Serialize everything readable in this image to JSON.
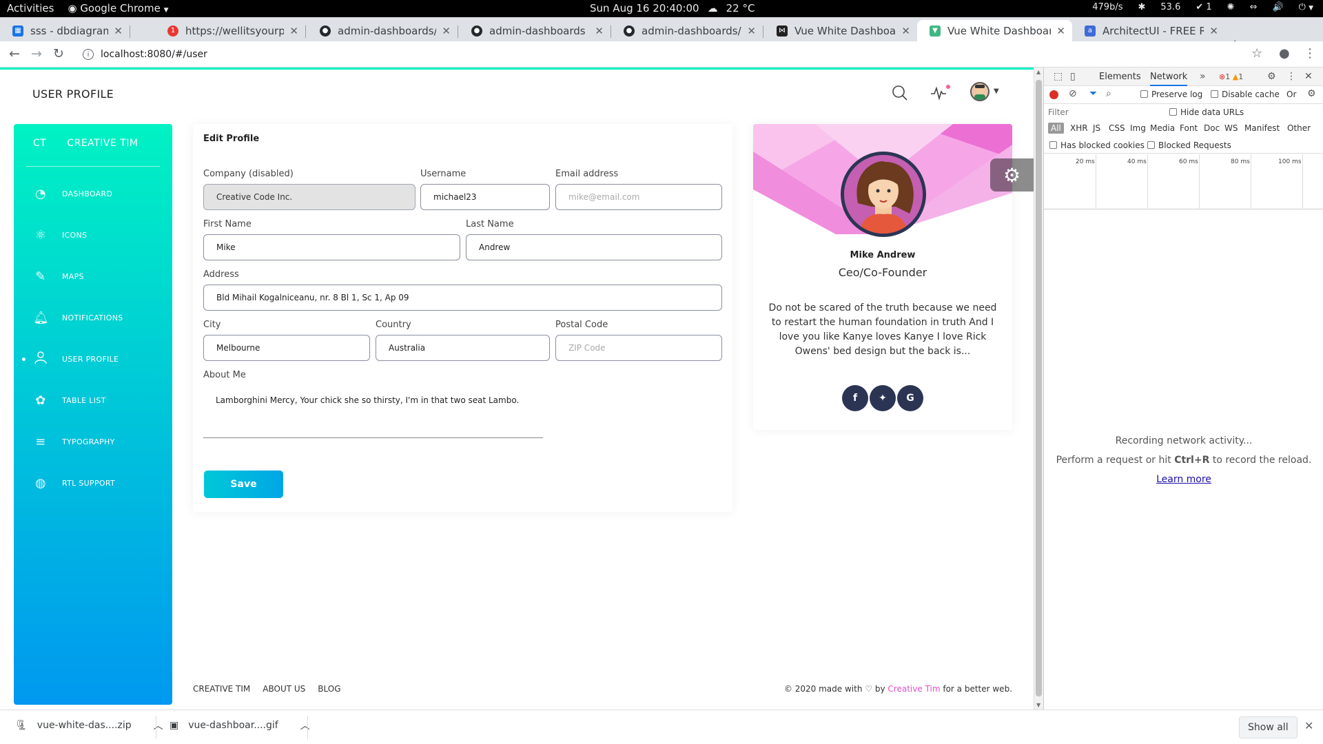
{
  "system_bar": {
    "activities": "Activities",
    "app_name": "Google Chrome",
    "clock": "Sun Aug 16  20:40:00",
    "weather": "22 °C",
    "net_speed": "479b/s",
    "value2": "53.6",
    "tray_indicator": "1"
  },
  "tabs": [
    {
      "label": "sss - dbdiagram.io"
    },
    {
      "label": "https://wellitsyourplac"
    },
    {
      "label": "admin-dashboards/bo"
    },
    {
      "label": "admin-dashboards (Ac"
    },
    {
      "label": "admin-dashboards/vu"
    },
    {
      "label": "Vue White Dashboard"
    },
    {
      "label": "Vue White Dashboard b"
    },
    {
      "label": "ArchitectUI - FREE Rea"
    }
  ],
  "tab_badge": "1",
  "url": "localhost:8080/#/user",
  "page": {
    "header_title": "USER PROFILE",
    "brand": {
      "short": "CT",
      "name": "CREATIVE TIM"
    },
    "sidebar": [
      {
        "label": "DASHBOARD"
      },
      {
        "label": "ICONS"
      },
      {
        "label": "MAPS"
      },
      {
        "label": "NOTIFICATIONS"
      },
      {
        "label": "USER PROFILE"
      },
      {
        "label": "TABLE LIST"
      },
      {
        "label": "TYPOGRAPHY"
      },
      {
        "label": "RTL SUPPORT"
      }
    ],
    "edit_profile": {
      "title": "Edit Profile",
      "company_label": "Company (disabled)",
      "company_value": "Creative Code Inc.",
      "username_label": "Username",
      "username_value": "michael23",
      "email_label": "Email address",
      "email_placeholder": "mike@email.com",
      "first_name_label": "First Name",
      "first_name_value": "Mike",
      "last_name_label": "Last Name",
      "last_name_value": "Andrew",
      "address_label": "Address",
      "address_value": "Bld Mihail Kogalniceanu, nr. 8 Bl 1, Sc 1, Ap 09",
      "city_label": "City",
      "city_value": "Melbourne",
      "country_label": "Country",
      "country_value": "Australia",
      "postal_label": "Postal Code",
      "postal_placeholder": "ZIP Code",
      "about_label": "About Me",
      "about_value": "Lamborghini Mercy, Your chick she so thirsty, I'm in that two seat Lambo.",
      "save_label": "Save"
    },
    "profile_card": {
      "name": "Mike Andrew",
      "role": "Ceo/Co-Founder",
      "bio": "Do not be scared of the truth because we need to restart the human foundation in truth And I love you like Kanye loves Kanye I love Rick Owens' bed design but the back is..."
    },
    "footer": {
      "links": [
        "CREATIVE TIM",
        "ABOUT US",
        "BLOG"
      ],
      "copy_prefix": "© 2020 made with",
      "copy_by": "by",
      "copy_link": "Creative Tim",
      "copy_suffix": "for a better web."
    },
    "colors": {
      "accent": "#00f2c3",
      "accent2": "#0098f0",
      "primary": "#e14eca"
    }
  },
  "devtools": {
    "tab_elements": "Elements",
    "tab_network": "Network",
    "errors": "1",
    "warnings": "1",
    "preserve_log": "Preserve log",
    "disable_cache": "Disable cache",
    "throttle": "Or",
    "filter_placeholder": "Filter",
    "hide_data_urls": "Hide data URLs",
    "types": [
      "All",
      "XHR",
      "JS",
      "CSS",
      "Img",
      "Media",
      "Font",
      "Doc",
      "WS",
      "Manifest",
      "Other"
    ],
    "has_blocked_cookies": "Has blocked cookies",
    "blocked_requests": "Blocked Requests",
    "timeline_ticks": [
      "20 ms",
      "40 ms",
      "60 ms",
      "80 ms",
      "100 ms"
    ],
    "empty_line1": "Recording network activity...",
    "empty_line2_a": "Perform a request or hit",
    "empty_line2_key": "Ctrl+R",
    "empty_line2_b": "to record the reload.",
    "learn_more": "Learn more"
  },
  "downloads": {
    "items": [
      {
        "name": "vue-white-das....zip"
      },
      {
        "name": "vue-dashboar....gif"
      }
    ],
    "show_all": "Show all"
  }
}
